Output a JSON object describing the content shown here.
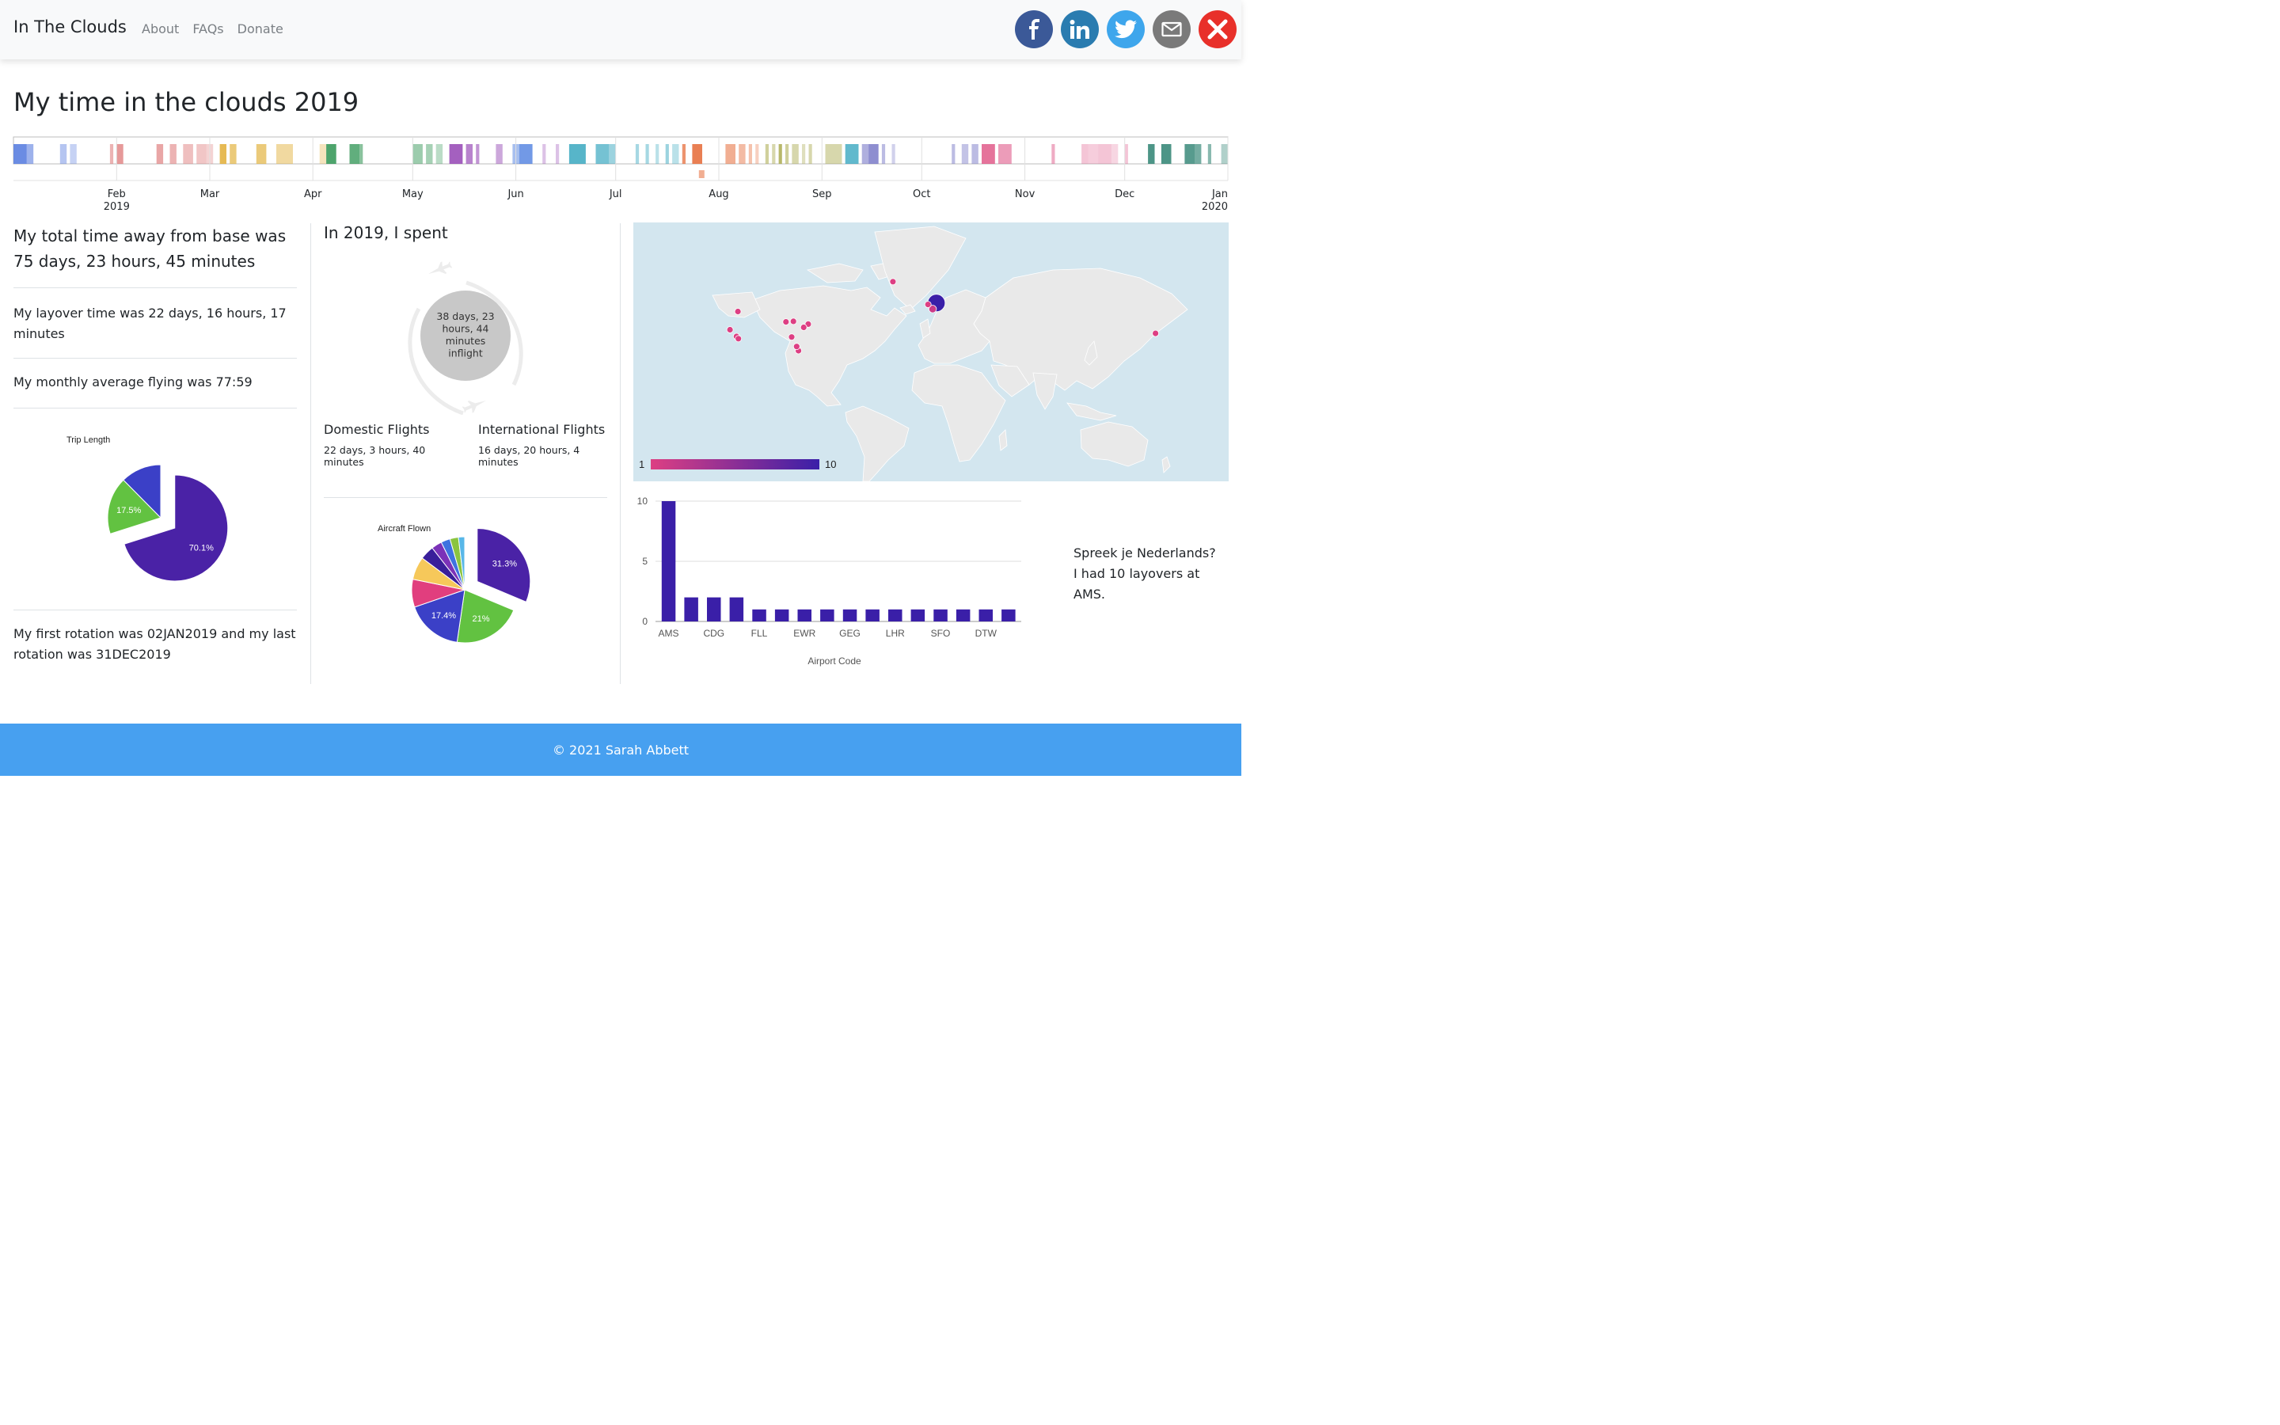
{
  "nav": {
    "brand": "In The Clouds",
    "links": [
      "About",
      "FAQs",
      "Donate"
    ]
  },
  "social": [
    {
      "name": "facebook",
      "color": "#3b5998",
      "icon": "facebook-icon"
    },
    {
      "name": "linkedin",
      "color": "#2a7cb0",
      "icon": "linkedin-icon"
    },
    {
      "name": "twitter",
      "color": "#3ea6ec",
      "icon": "twitter-icon"
    },
    {
      "name": "email",
      "color": "#7a7a7a",
      "icon": "mail-icon"
    },
    {
      "name": "close",
      "color": "#e8302a",
      "icon": "close-icon"
    }
  ],
  "page_title": "My time in the clouds 2019",
  "timeline": {
    "ticks": [
      {
        "label": "Feb",
        "sub": "2019"
      },
      {
        "label": "Mar",
        "sub": ""
      },
      {
        "label": "Apr",
        "sub": ""
      },
      {
        "label": "May",
        "sub": ""
      },
      {
        "label": "Jun",
        "sub": ""
      },
      {
        "label": "Jul",
        "sub": ""
      },
      {
        "label": "Aug",
        "sub": ""
      },
      {
        "label": "Sep",
        "sub": ""
      },
      {
        "label": "Oct",
        "sub": ""
      },
      {
        "label": "Nov",
        "sub": ""
      },
      {
        "label": "Dec",
        "sub": ""
      },
      {
        "label": "Jan",
        "sub": "2020"
      }
    ]
  },
  "left": {
    "total_line1": "My total time away from base was",
    "total_line2": "75 days, 23 hours, 45 minutes",
    "layover": "My layover time was 22 days, 16 hours, 17 minutes",
    "monthly": "My monthly average flying was 77:59",
    "rotation": "My first rotation was 02JAN2019 and my last rotation was 31DEC2019"
  },
  "mid": {
    "heading": "In 2019, I spent",
    "inflight": [
      "38 days, 23",
      "hours, 44",
      "minutes",
      "inflight"
    ],
    "domestic_label": "Domestic Flights",
    "domestic_value": "22 days, 3 hours, 40 minutes",
    "international_label": "International Flights",
    "international_value": "16 days, 20 hours, 4 minutes"
  },
  "map": {
    "legend_min": "1",
    "legend_max": "10",
    "colors": {
      "low": "#dd3f83",
      "high": "#3a1fa8",
      "ocean": "#d3e6ef",
      "land": "#e9e9e9"
    }
  },
  "dutch": "Spreek je Nederlands? I had 10 layovers at AMS.",
  "footer": "© 2021 Sarah Abbett",
  "chart_data": [
    {
      "type": "pie",
      "title": "Trip Length",
      "slices": [
        {
          "value": 70.1,
          "label": "70.1%",
          "color": "#4a22a6"
        },
        {
          "value": 17.5,
          "label": "17.5%",
          "color": "#62c241"
        },
        {
          "value": 12.4,
          "label": "",
          "color": "#3b40c7"
        }
      ]
    },
    {
      "type": "pie",
      "title": "Aircraft Flown",
      "slices": [
        {
          "value": 31.3,
          "label": "31.3%",
          "color": "#4a22a6"
        },
        {
          "value": 21.0,
          "label": "21%",
          "color": "#62c241"
        },
        {
          "value": 17.4,
          "label": "17.4%",
          "color": "#3b40c7"
        },
        {
          "value": 8.5,
          "label": "",
          "color": "#e13e7e"
        },
        {
          "value": 7.0,
          "label": "",
          "color": "#f6c85a"
        },
        {
          "value": 4.3,
          "label": "",
          "color": "#3a1f9a"
        },
        {
          "value": 3.2,
          "label": "",
          "color": "#7b32b8"
        },
        {
          "value": 2.8,
          "label": "",
          "color": "#3e73e0"
        },
        {
          "value": 2.6,
          "label": "",
          "color": "#8ac43f"
        },
        {
          "value": 1.9,
          "label": "",
          "color": "#58b7e8"
        }
      ]
    },
    {
      "type": "bar",
      "xlabel": "Airport Code",
      "ylabel": "",
      "ylim": [
        0,
        10
      ],
      "yticks": [
        0,
        5,
        10
      ],
      "categories": [
        "AMS",
        "",
        "CDG",
        "",
        "FLL",
        "",
        "EWR",
        "",
        "GEG",
        "",
        "LHR",
        "",
        "SFO",
        "",
        "DTW",
        ""
      ],
      "values": [
        10,
        2,
        2,
        2,
        1,
        1,
        1,
        1,
        1,
        1,
        1,
        1,
        1,
        1,
        1,
        1
      ],
      "color": "#3a1fa8"
    },
    {
      "type": "scatter",
      "title": "",
      "points": [
        {
          "lon": 4.8,
          "lat": 52.3,
          "count": 10
        },
        {
          "lon": -22,
          "lat": 64,
          "count": 1
        },
        {
          "lon": -0.4,
          "lat": 51.5,
          "count": 1
        },
        {
          "lon": 2.5,
          "lat": 49.0,
          "count": 2
        },
        {
          "lon": 139.8,
          "lat": 35.6,
          "count": 1
        },
        {
          "lon": -122.4,
          "lat": 37.6,
          "count": 1
        },
        {
          "lon": -118.4,
          "lat": 33.9,
          "count": 1
        },
        {
          "lon": -117.2,
          "lat": 32.7,
          "count": 1
        },
        {
          "lon": -117.5,
          "lat": 47.6,
          "count": 1
        },
        {
          "lon": -83.3,
          "lat": 42.2,
          "count": 1
        },
        {
          "lon": -87.9,
          "lat": 41.9,
          "count": 1
        },
        {
          "lon": -84.4,
          "lat": 33.6,
          "count": 1
        },
        {
          "lon": -74.2,
          "lat": 40.7,
          "count": 1
        },
        {
          "lon": -77.0,
          "lat": 38.9,
          "count": 1
        },
        {
          "lon": -80.2,
          "lat": 26.1,
          "count": 1
        },
        {
          "lon": -81.3,
          "lat": 28.4,
          "count": 1
        }
      ]
    }
  ]
}
